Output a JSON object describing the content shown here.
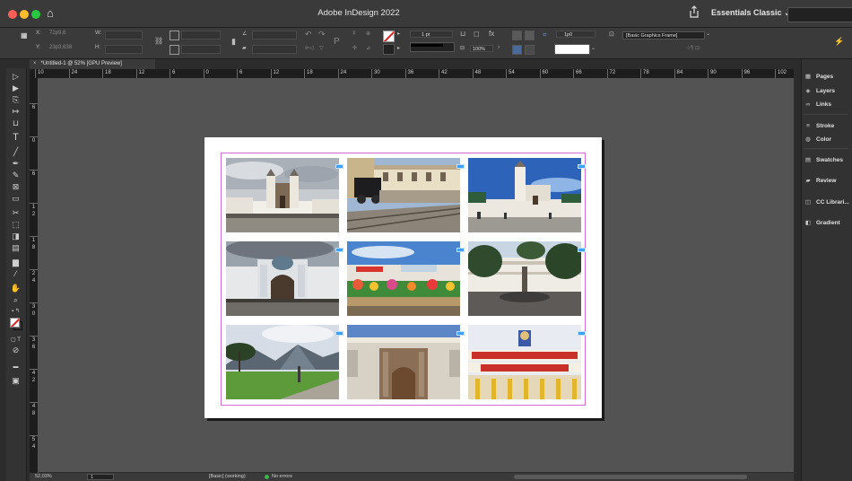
{
  "window": {
    "title": "Adobe InDesign 2022",
    "workspace": "Essentials Classic"
  },
  "colors": {
    "accent": "#3ea0ff",
    "margin_guide": "#d66ad6",
    "pasteboard": "#535353",
    "chrome": "#3a3a3a"
  },
  "control_bar": {
    "x_label": "X:",
    "x_value": "72p9,6",
    "y_label": "Y:",
    "y_value": "23p3,638",
    "w_label": "W:",
    "h_label": "H:",
    "stroke_weight": "1 pt",
    "scale_percent": "100%",
    "spacing_value": "1p0",
    "frame_style": "[Basic Graphics Frame]"
  },
  "document_tab": {
    "label": "*Untitled-1 @ 52% [GPU Preview]",
    "close_glyph": "×"
  },
  "hruler": {
    "ticks": [
      "10",
      "24",
      "18",
      "12",
      "6",
      "0",
      "6",
      "12",
      "18",
      "24",
      "30",
      "36",
      "42",
      "48",
      "54",
      "60",
      "66",
      "72",
      "78",
      "84",
      "90",
      "96",
      "102"
    ]
  },
  "vruler": {
    "ticks": [
      "6",
      "0",
      "6",
      "1\n2",
      "1\n8",
      "2\n4",
      "3\n0",
      "3\n6",
      "4\n2",
      "4\n8",
      "5\n4"
    ]
  },
  "photos": [
    {
      "name": "photo-san-francisco-church"
    },
    {
      "name": "photo-train-station"
    },
    {
      "name": "photo-santo-domingo-church"
    },
    {
      "name": "photo-ornate-cathedral"
    },
    {
      "name": "photo-colorful-market"
    },
    {
      "name": "photo-plaza-grande"
    },
    {
      "name": "photo-mountain-park"
    },
    {
      "name": "photo-carved-stone-portal"
    },
    {
      "name": "photo-olympic-stadium"
    }
  ],
  "panels": [
    {
      "label": "Pages",
      "icon": "pages-icon",
      "glyph": "▦"
    },
    {
      "label": "Layers",
      "icon": "layers-icon",
      "glyph": "◈"
    },
    {
      "label": "Links",
      "icon": "links-icon",
      "glyph": "∞"
    },
    {
      "label": "Stroke",
      "icon": "stroke-icon",
      "glyph": "≡"
    },
    {
      "label": "Color",
      "icon": "color-icon",
      "glyph": "◍"
    },
    {
      "label": "Swatches",
      "icon": "swatches-icon",
      "glyph": "▤"
    },
    {
      "label": "Review",
      "icon": "review-icon",
      "glyph": "▰"
    },
    {
      "label": "CC Librari...",
      "icon": "cc-libraries-icon",
      "glyph": "◫"
    },
    {
      "label": "Gradient",
      "icon": "gradient-icon",
      "glyph": "◧"
    }
  ],
  "status": {
    "zoom": "52,03%",
    "page": "1",
    "profile": "[Basic] (working)",
    "errors": "No errors"
  }
}
